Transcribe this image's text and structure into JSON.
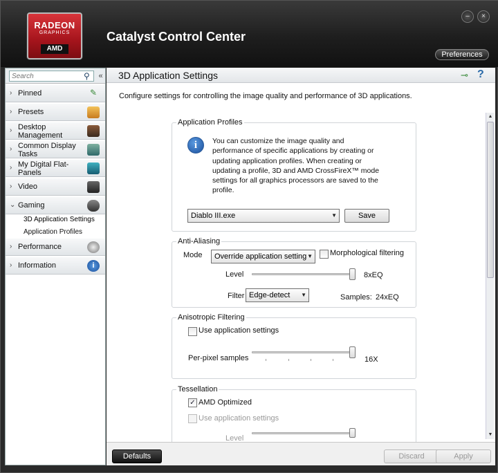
{
  "window": {
    "brand_logo_top": "RADEON",
    "brand_logo_sub": "GRAPHICS",
    "brand_logo_maker": "AMD",
    "title": "Catalyst Control Center",
    "preferences_label": "Preferences",
    "minimize_symbol": "–",
    "close_symbol": "×"
  },
  "sidebar": {
    "search_placeholder": "Search",
    "collapse_symbol": "«",
    "items": [
      {
        "label": "Pinned",
        "icon": "pin-icon"
      },
      {
        "label": "Presets",
        "icon": "presets-icon"
      },
      {
        "label": "Desktop Management",
        "icon": "desktop-management-icon"
      },
      {
        "label": "Common Display Tasks",
        "icon": "display-tasks-icon"
      },
      {
        "label": "My Digital Flat-Panels",
        "icon": "flat-panel-icon"
      },
      {
        "label": "Video",
        "icon": "video-camera-icon"
      },
      {
        "label": "Gaming",
        "icon": "gamepad-icon"
      },
      {
        "label": "Performance",
        "icon": "gauge-icon"
      },
      {
        "label": "Information",
        "icon": "info-icon"
      }
    ],
    "gaming_subitems": [
      "3D Application Settings",
      "Application Profiles"
    ]
  },
  "main": {
    "title": "3D Application Settings",
    "description": "Configure settings for controlling the image quality and performance of 3D applications.",
    "application_profiles": {
      "title": "Application Profiles",
      "info_text": "You can customize the image quality and performance of specific applications by creating or updating application profiles. When creating or updating a profile, 3D and AMD CrossFireX™ mode settings for all graphics processors are saved to the profile.",
      "selected_profile": "Diablo III.exe",
      "save_label": "Save"
    },
    "anti_aliasing": {
      "title": "Anti-Aliasing",
      "mode_label": "Mode",
      "mode_value": "Override application setting",
      "morphological_label": "Morphological filtering",
      "morphological_checked": false,
      "level_label": "Level",
      "level_value": "8xEQ",
      "filter_label": "Filter",
      "filter_value": "Edge-detect",
      "samples_label": "Samples:",
      "samples_value": "24xEQ"
    },
    "anisotropic": {
      "title": "Anisotropic Filtering",
      "use_app_label": "Use application settings",
      "use_app_checked": false,
      "per_pixel_label": "Per-pixel samples",
      "per_pixel_value": "16X"
    },
    "tessellation": {
      "title": "Tessellation",
      "amd_optimized_label": "AMD Optimized",
      "amd_optimized_checked": true,
      "use_app_label": "Use application settings",
      "use_app_checked": false,
      "level_label": "Level"
    }
  },
  "footer": {
    "defaults_label": "Defaults",
    "discard_label": "Discard",
    "apply_label": "Apply"
  }
}
